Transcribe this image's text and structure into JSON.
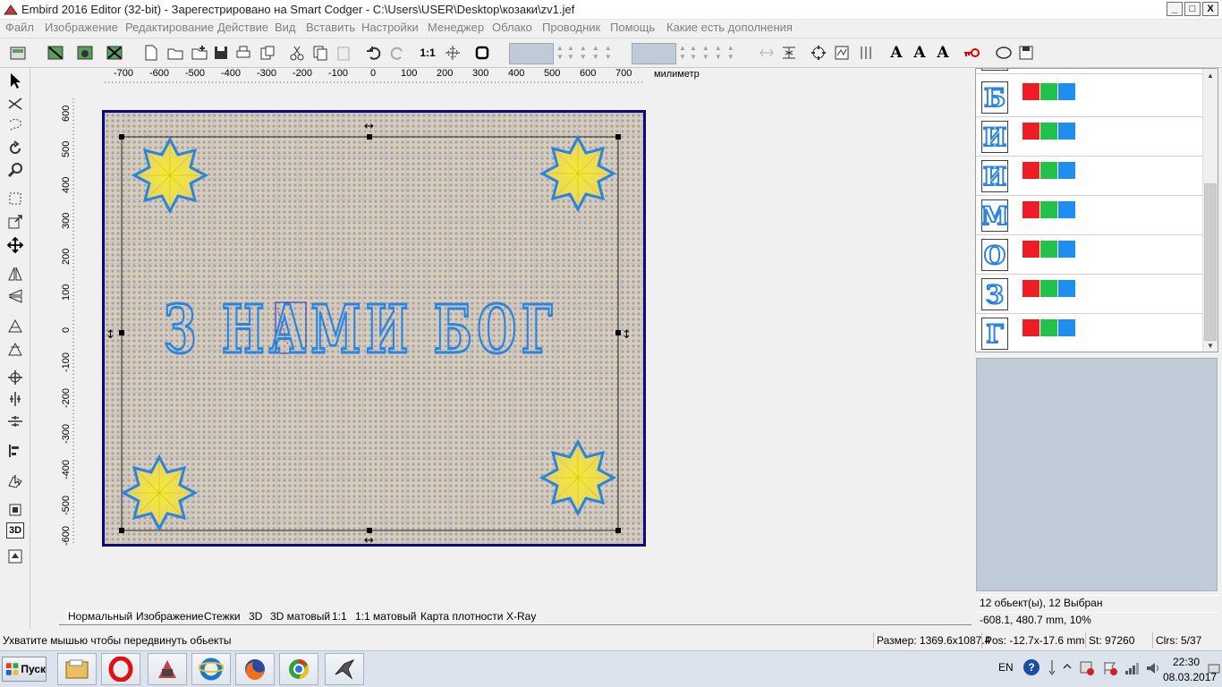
{
  "window": {
    "title": "Embird 2016 Editor (32-bit) - Зарегестрировано на Smart Codger - C:\\Users\\USER\\Desktop\\козаки\\zv1.jef",
    "minimize": "_",
    "maximize": "□",
    "close": "X"
  },
  "menu": [
    "Файл",
    "Изображение",
    "Редактирование",
    "Действие",
    "Вид",
    "Вставить",
    "Настройки",
    "Менеджер",
    "Облако",
    "Проводник",
    "Помощь",
    "Какие есть дополнения"
  ],
  "toolbar": {
    "text_tools": [
      "A",
      "A",
      "A"
    ],
    "one_to_one": "1:1"
  },
  "ruler": {
    "unit": "милиметр",
    "h_labels": [
      "-700",
      "-600",
      "-500",
      "-400",
      "-300",
      "-200",
      "-100",
      "0",
      "100",
      "200",
      "300",
      "400",
      "500",
      "600",
      "700"
    ],
    "v_labels": [
      "600",
      "500",
      "400",
      "300",
      "200",
      "100",
      "0",
      "-100",
      "-200",
      "-300",
      "-400",
      "-500",
      "-600"
    ]
  },
  "left_tools": {
    "three_d": "3D"
  },
  "canvas": {
    "design_text": "З НАМИ БОГ",
    "hoop_color": "#d8cdb8",
    "thread_color": "#2a84e0",
    "star_fill": "#f2ea3c"
  },
  "object_list": {
    "items": [
      {
        "letter": "Б"
      },
      {
        "letter": "И"
      },
      {
        "letter": "И"
      },
      {
        "letter": "М"
      },
      {
        "letter": "О"
      },
      {
        "letter": "З"
      },
      {
        "letter": "Г"
      }
    ],
    "swatch_colors": [
      "#ee1c24",
      "#22c24a",
      "#1e8ef0"
    ]
  },
  "info": {
    "selection": "12 обьект(ы), 12 Выбран",
    "coords": "-608.1, 480.7 mm, 10%"
  },
  "tabs": [
    "Нормальный",
    "Изображение",
    "Стежки",
    "3D",
    "3D матовый",
    "1:1",
    "1:1 матовый",
    "Карта плотности",
    "X-Ray"
  ],
  "status": {
    "hint": "Ухватите мышью чтобы передвинуть обьекты",
    "size": "Размер: 1369.6x1087.4",
    "pos": "Pos: -12.7x-17.6 mm",
    "stitches": "St: 97260",
    "colors": "Clrs: 5/37"
  },
  "taskbar": {
    "start": "Пуск",
    "lang": "EN",
    "help": "?",
    "time": "22:30",
    "date": "08.03.2017",
    "apps": [
      "file-manager-icon",
      "opera-icon",
      "embird-icon",
      "ie-icon",
      "firefox-icon",
      "chrome-icon",
      "bird-app-icon"
    ]
  }
}
